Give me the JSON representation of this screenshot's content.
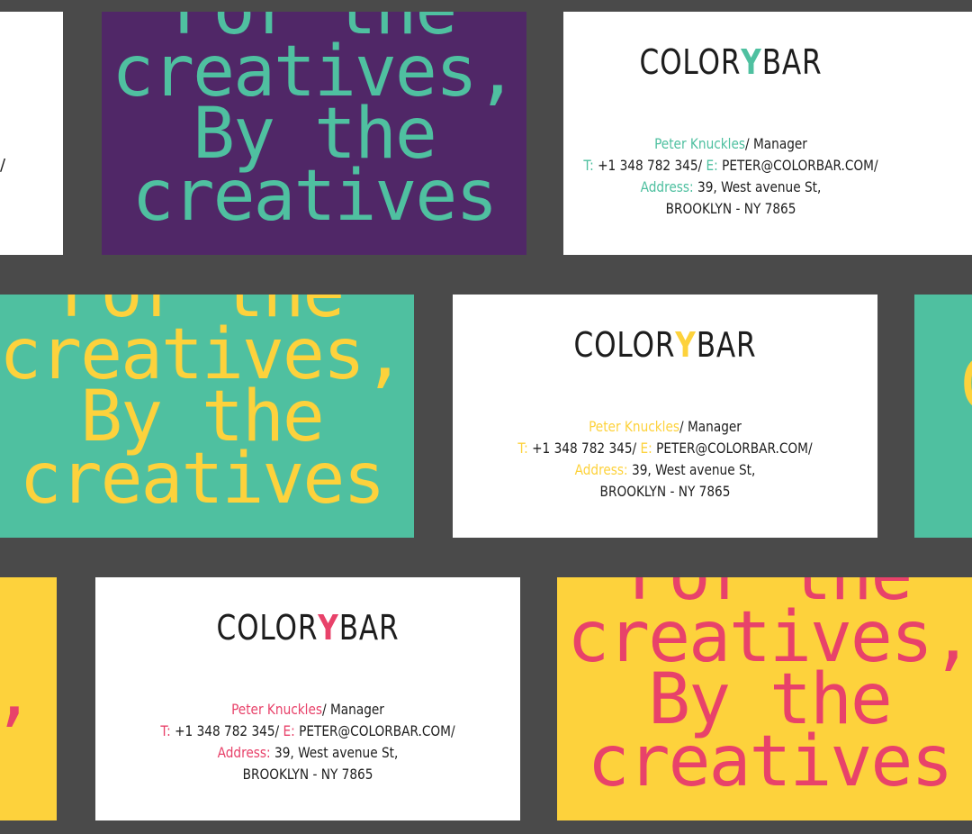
{
  "colors": {
    "background": "#4a4a4a",
    "purple": "#502767",
    "teal": "#4fc0a0",
    "yellow": "#fdd23c",
    "pink": "#e8426a",
    "black": "#1d1d1d"
  },
  "slogan": {
    "line1": "For the",
    "line2": "creatives,",
    "line3": "By the",
    "line4": "creatives"
  },
  "logo": {
    "left": "COLOR",
    "mark": "Y",
    "right": "BAR"
  },
  "contact": {
    "name": "Peter Knuckles",
    "role": "/ Manager",
    "tel_label": "T:",
    "tel": " +1 348 782 345/ ",
    "email_label": "E:",
    "email": " PETER@COLORBAR.COM/",
    "address_label": "Address:",
    "address": " 39, West avenue St,",
    "city": "BROOKLYN - NY 7865"
  },
  "partials": {
    "slash": "/",
    "comma": ",",
    "letter_c": "C"
  }
}
